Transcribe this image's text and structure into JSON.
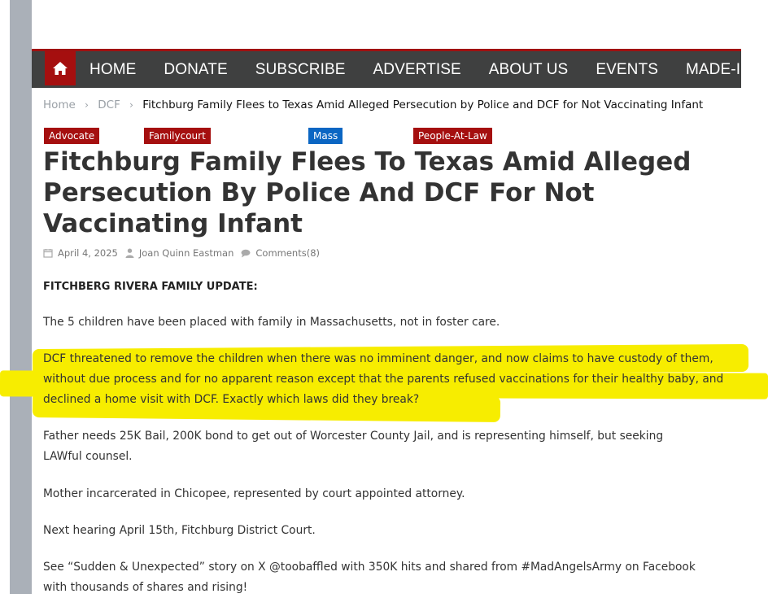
{
  "nav": {
    "items": [
      "HOME",
      "DONATE",
      "SUBSCRIBE",
      "ADVERTISE",
      "ABOUT US",
      "EVENTS",
      "MADE-IN-USA"
    ],
    "home_icon": "home-icon"
  },
  "breadcrumb": {
    "home": "Home",
    "section": "DCF",
    "current": "Fitchburg Family Flees to Texas Amid Alleged Persecution by Police and DCF for Not Vaccinating Infant"
  },
  "tags": [
    "Advocate",
    "Familycourt",
    "Mass",
    "People-At-Law"
  ],
  "article": {
    "title": "Fitchburg Family Flees To Texas Amid Alleged Persecution By Police And DCF For Not Vaccinating Infant",
    "date": "April 4, 2025",
    "author": "Joan Quinn Eastman",
    "comments": "Comments(8)",
    "heading": "FITCHBERG RIVERA FAMILY UPDATE:",
    "paragraphs": [
      "The 5 children have been placed with family in Massachusetts, not in foster care.",
      "DCF threatened to remove the children when there was no imminent danger, and now claims to have custody of them, without due process and for no apparent reason except that the parents refused vaccinations for their healthy baby, and declined a home visit with DCF. Exactly which laws did they break?",
      "Father needs 25K Bail, 200K bond to get out of Worcester County Jail, and is representing himself, but seeking LAWful counsel.",
      "Mother incarcerated in Chicopee, represented by court appointed attorney.",
      "Next hearing April 15th, Fitchburg District Court.",
      "See “Sudden & Unexpected” story on X @toobaffled with 350K hits and shared from #MadAngelsArmy on Facebook with thousands of shares and rising!"
    ]
  },
  "colors": {
    "nav_bg": "#3f4040",
    "accent_red": "#a50f0f",
    "tag_blue": "#0b66c3",
    "highlight": "#f7ed00",
    "side_bar": "#aab0b8"
  }
}
